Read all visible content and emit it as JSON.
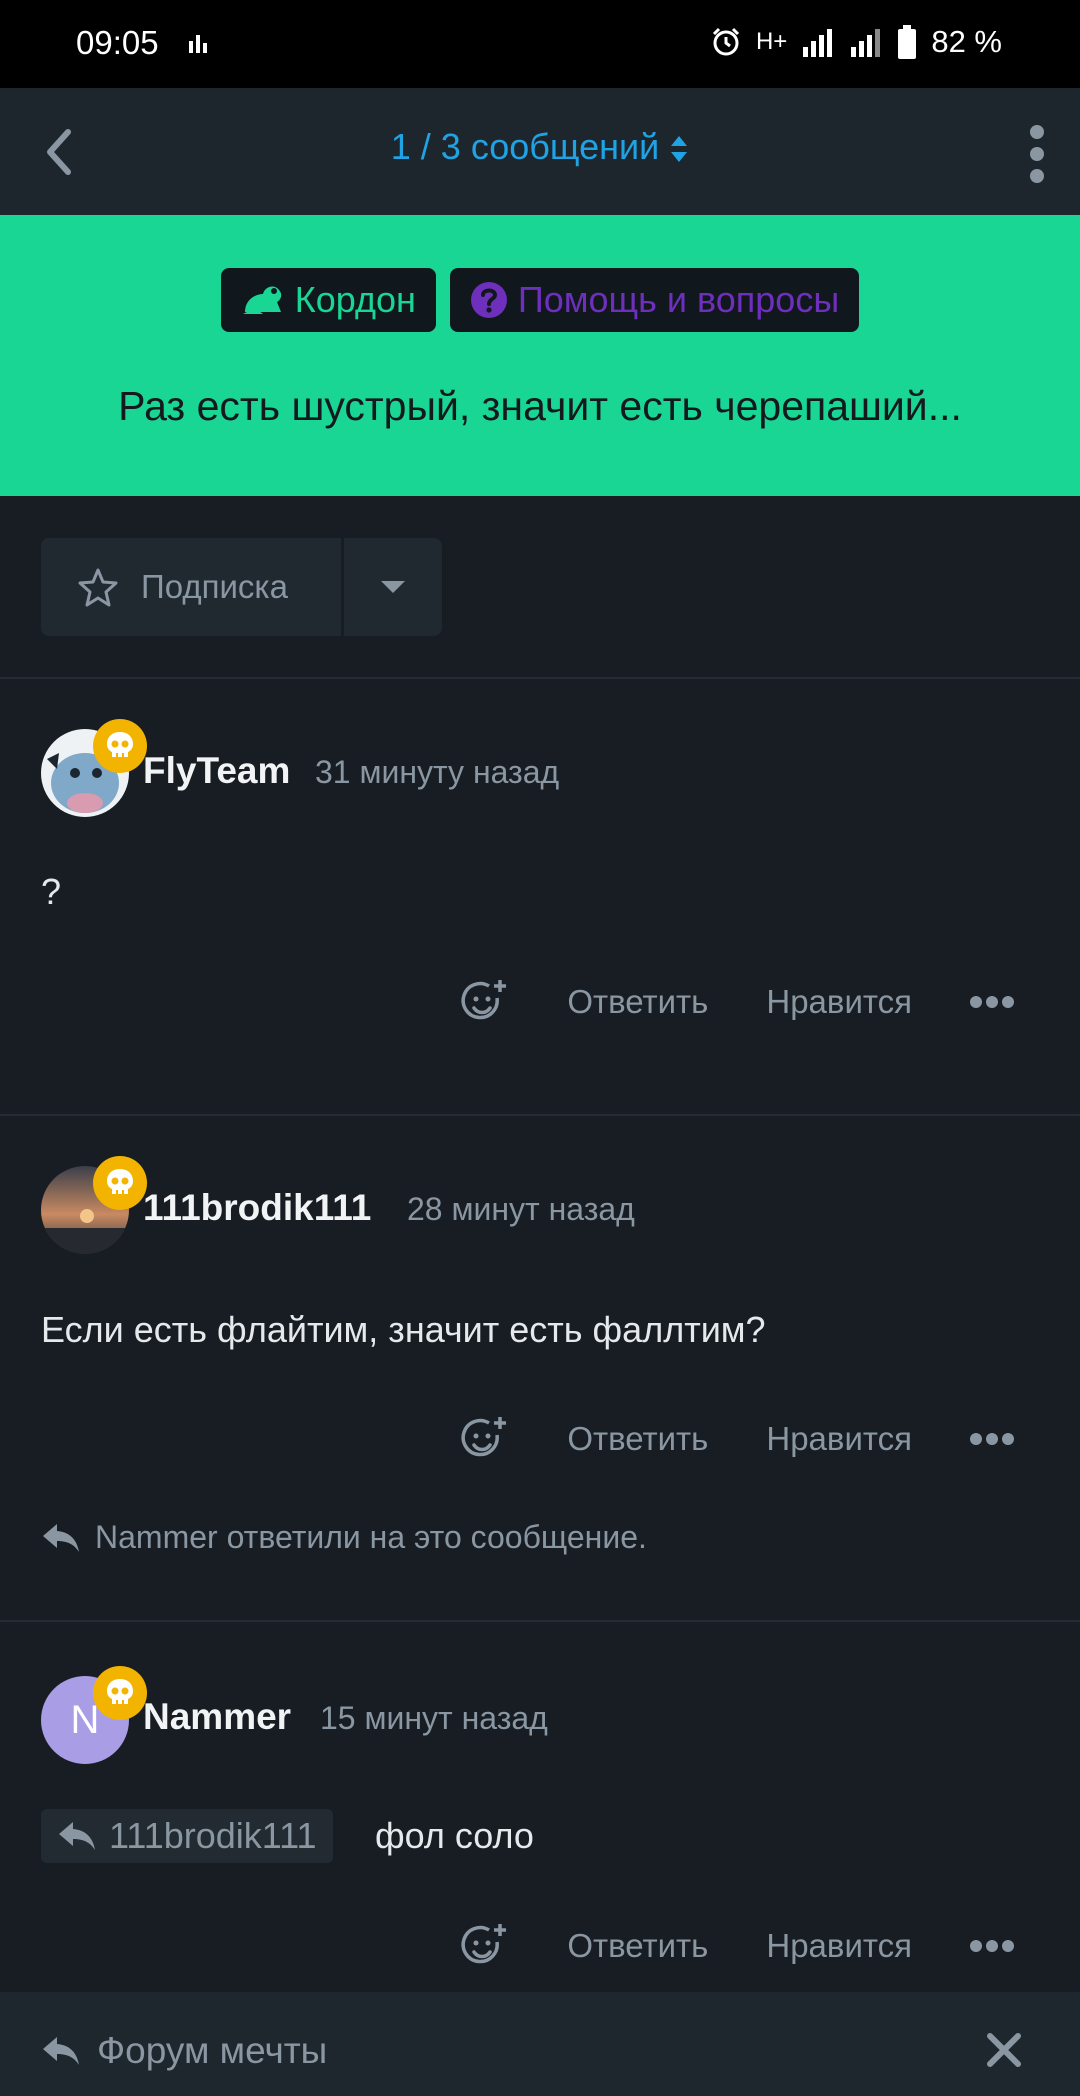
{
  "status_bar": {
    "time": "09:05",
    "network": "H+",
    "battery": "82 %"
  },
  "nav": {
    "title": "1 / 3 сообщений"
  },
  "thread": {
    "tags": [
      "Кордон",
      "Помощь и вопросы"
    ],
    "title": "Раз есть шустрый, значит есть черепаший..."
  },
  "subscribe": {
    "label": "Подписка"
  },
  "actions": {
    "reply": "Ответить",
    "like": "Нравится"
  },
  "posts": [
    {
      "author": "FlyTeam",
      "time": "31 минуту назад",
      "text": "?"
    },
    {
      "author": "111brodik111",
      "time": "28 минут назад",
      "text": "Если есть флайтим, значит есть фаллтим?",
      "replied_note": "Nammer ответили на это сообщение."
    },
    {
      "author": "Nammer",
      "avatar_letter": "N",
      "time": "15 минут назад",
      "quote_author": "111brodik111",
      "text": "фол соло"
    }
  ],
  "bottom_bar": {
    "label": "Форум мечты"
  },
  "colors": {
    "accent_green": "#1ad695",
    "accent_blue": "#1fa3e5",
    "tag_purple": "#6e2fbd",
    "badge_gold": "#f2b400",
    "background": "#171d23"
  }
}
